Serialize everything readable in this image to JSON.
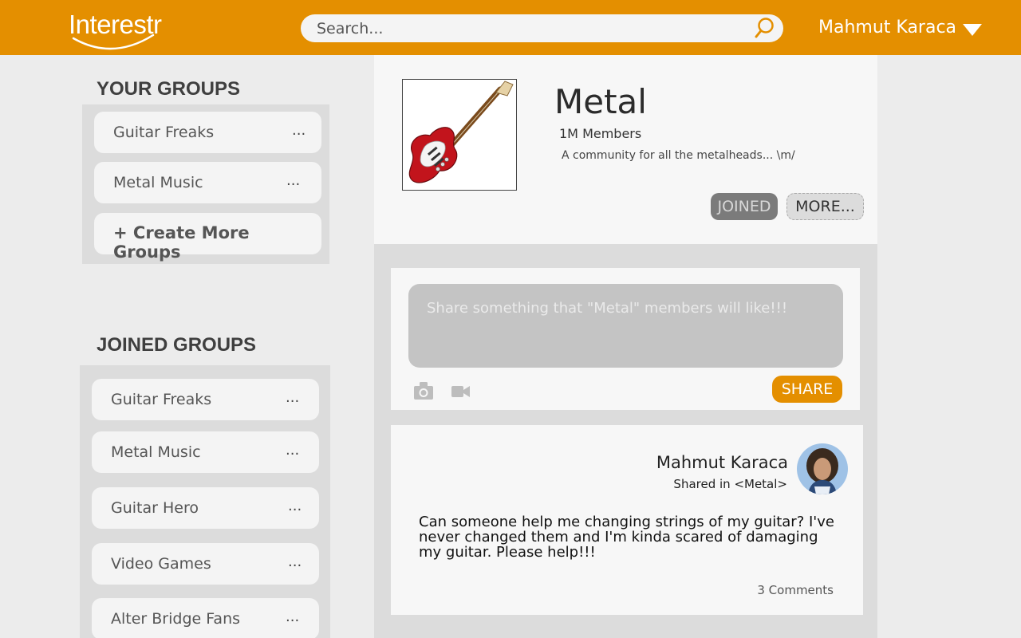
{
  "header": {
    "logo_text": "Interestr",
    "search_placeholder": "Search...",
    "user_name": "Mahmut Karaca",
    "accent_color": "#e48f00"
  },
  "your_groups": {
    "title": "YOUR GROUPS",
    "items": [
      {
        "label": "Guitar Freaks",
        "menu": "..."
      },
      {
        "label": "Metal Music",
        "menu": "..."
      }
    ],
    "create_label": "+ Create More Groups"
  },
  "joined_groups": {
    "title": "JOINED GROUPS",
    "items": [
      {
        "label": "Guitar Freaks",
        "menu": "..."
      },
      {
        "label": "Metal Music",
        "menu": "..."
      },
      {
        "label": "Guitar Hero",
        "menu": "..."
      },
      {
        "label": "Video Games",
        "menu": "..."
      },
      {
        "label": "Alter Bridge Fans",
        "menu": "..."
      }
    ]
  },
  "group": {
    "name": "Metal",
    "members": "1M Members",
    "description": "A community for all the metalheads... \\m/",
    "joined_label": "JOINED",
    "more_label": "MORE..."
  },
  "composer": {
    "placeholder": "Share something that \"Metal\" members will like!!!",
    "share_label": "SHARE",
    "icons": [
      "camera-icon",
      "video-icon"
    ]
  },
  "post": {
    "author": "Mahmut Karaca",
    "shared_in": "Shared in <Metal>",
    "body": "Can someone help me changing strings of my guitar? I've never changed them and I'm kinda scared of damaging my guitar. Please help!!!",
    "comments": "3 Comments"
  }
}
